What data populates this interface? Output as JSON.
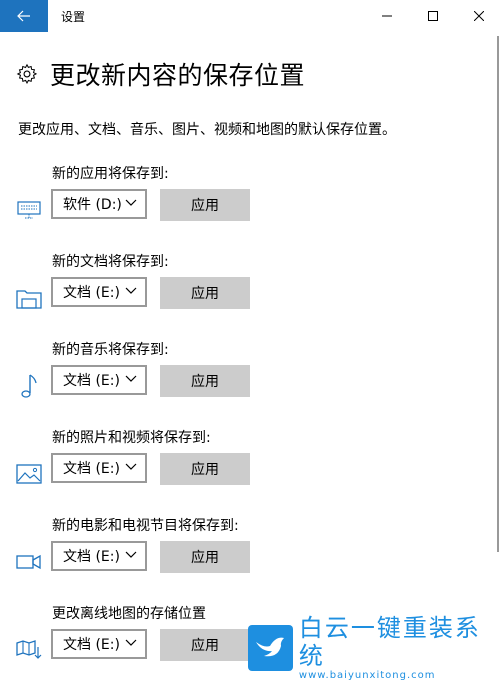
{
  "window": {
    "title": "设置",
    "colors": {
      "accent": "#1e73be",
      "button_bg": "#cccccc",
      "icon": "#1e73be"
    }
  },
  "header": {
    "title": "更改新内容的保存位置",
    "icon": "gear-icon"
  },
  "description": "更改应用、文档、音乐、图片、视频和地图的默认保存位置。",
  "sections": [
    {
      "label": "新的应用将保存到:",
      "drive": "软件 (D:)",
      "apply": "应用",
      "icon": "monitor-icon"
    },
    {
      "label": "新的文档将保存到:",
      "drive": "文档 (E:)",
      "apply": "应用",
      "icon": "folder-icon"
    },
    {
      "label": "新的音乐将保存到:",
      "drive": "文档 (E:)",
      "apply": "应用",
      "icon": "music-note-icon"
    },
    {
      "label": "新的照片和视频将保存到:",
      "drive": "文档 (E:)",
      "apply": "应用",
      "icon": "picture-icon"
    },
    {
      "label": "新的电影和电视节目将保存到:",
      "drive": "文档 (E:)",
      "apply": "应用",
      "icon": "video-camera-icon"
    },
    {
      "label": "更改离线地图的存储位置",
      "drive": "文档 (E:)",
      "apply": "应用",
      "icon": "map-download-icon"
    }
  ],
  "watermark": {
    "main": "白云一键重装系统",
    "sub": "www.baiyunxitong.com"
  }
}
